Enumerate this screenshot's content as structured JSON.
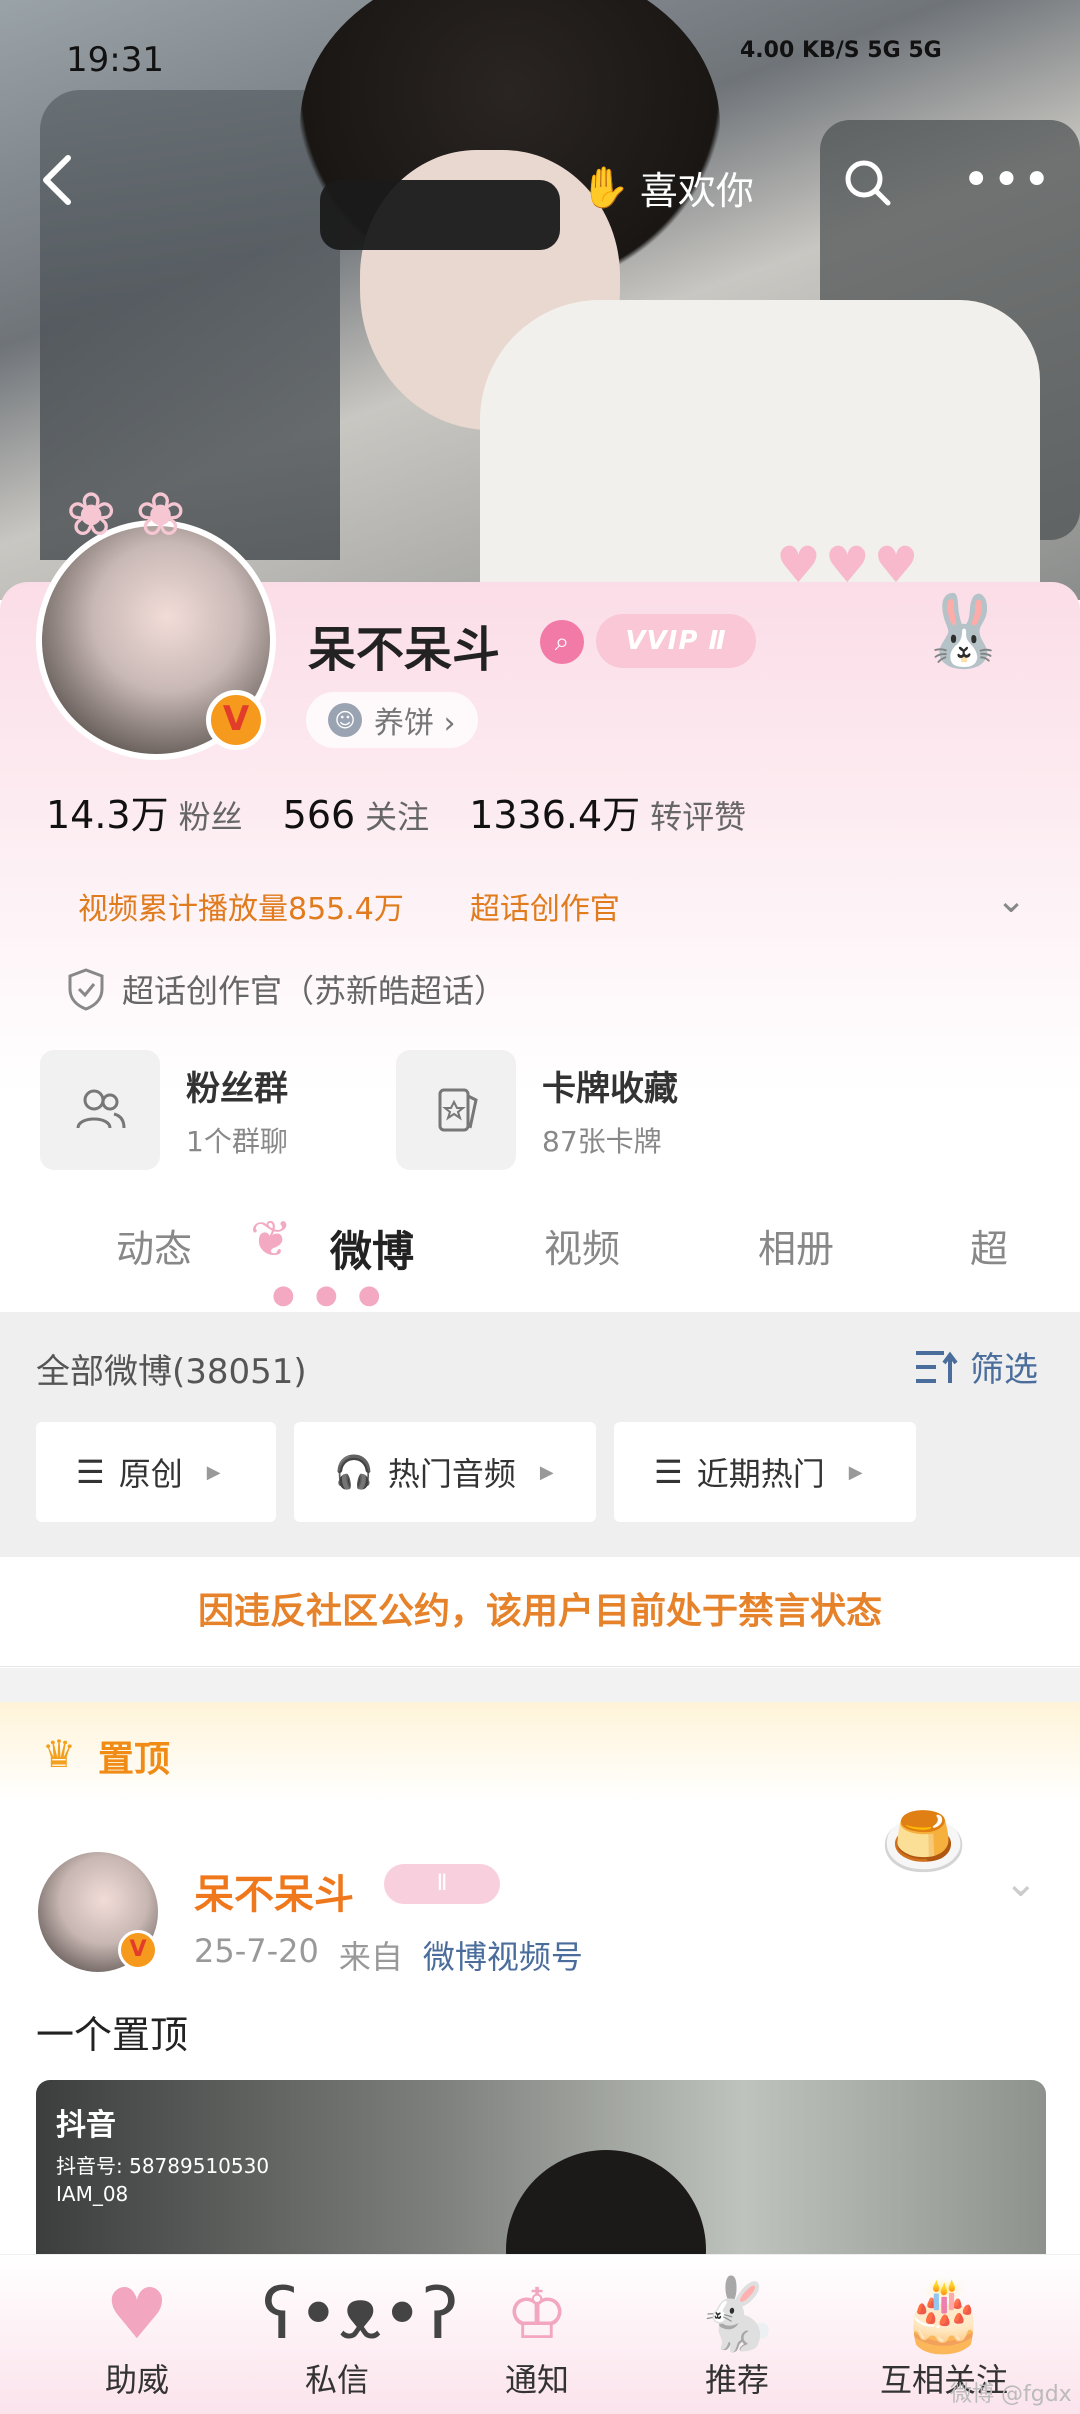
{
  "status_bar": {
    "time": "19:31",
    "right": "4.00 KB/S  5G  5G"
  },
  "nav": {
    "back": "‹",
    "like_label": "喜欢你",
    "more": "•••"
  },
  "profile": {
    "name": "呆不呆斗",
    "vip_label": "VVIP Ⅱ",
    "verified_badge": "V",
    "chip_label": "养饼 ›",
    "stats": [
      {
        "num": "14.3万",
        "label": "粉丝"
      },
      {
        "num": "566",
        "label": "关注"
      },
      {
        "num": "1336.4万",
        "label": "转评赞"
      }
    ],
    "tags": [
      "视频累计播放量855.4万",
      "超话创作官"
    ],
    "super_topic": "超话创作官（苏新皓超话）",
    "tiles": [
      {
        "title": "粉丝群",
        "sub": "1个群聊",
        "icon": "group-icon"
      },
      {
        "title": "卡牌收藏",
        "sub": "87张卡牌",
        "icon": "card-icon"
      }
    ]
  },
  "tabs": [
    "动态",
    "微博",
    "视频",
    "相册",
    "超"
  ],
  "feed": {
    "title": "全部微博(38051)",
    "filter_label": "筛选",
    "pills": [
      "原创",
      "热门音频",
      "近期热门"
    ],
    "banned_notice": "因违反社区公约，该用户目前处于禁言状态"
  },
  "pinned": {
    "label": "置顶",
    "author": "呆不呆斗",
    "author_badge": "Ⅱ",
    "date": "25-7-20",
    "from_label": "来自",
    "source": "微博视频号",
    "text": "一个置顶",
    "media": {
      "app": "抖音",
      "douyin_id": "抖音号: 58789510530",
      "account": "IAM_08"
    }
  },
  "bottom_bar": [
    {
      "label": "助威",
      "icon": "heart-icon"
    },
    {
      "label": "私信",
      "icon": "bear-icon"
    },
    {
      "label": "通知",
      "icon": "crown-icon"
    },
    {
      "label": "推荐",
      "icon": "bunny-icon"
    },
    {
      "label": "互相关注",
      "icon": "cake-icon"
    }
  ],
  "watermark": "微博 @fgdx",
  "colors": {
    "accent_orange": "#e6822a",
    "link_blue": "#4a6d9c",
    "pink": "#f3a9c2"
  }
}
